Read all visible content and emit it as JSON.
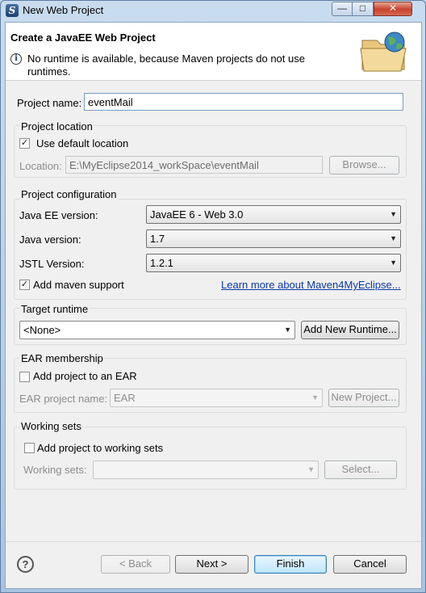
{
  "window": {
    "title": "New Web Project",
    "minimize_glyph": "—",
    "maximize_glyph": "□",
    "close_glyph": "✕"
  },
  "header": {
    "title": "Create a JavaEE Web Project",
    "message": "No runtime is available, because Maven projects do not use runtimes."
  },
  "project_name": {
    "label": "Project name:",
    "value": "eventMail"
  },
  "location_group": {
    "title": "Project location",
    "use_default_label": "Use default location",
    "use_default_checked": true,
    "location_label": "Location:",
    "location_value": "E:\\MyEclipse2014_workSpace\\eventMail",
    "browse_label": "Browse..."
  },
  "config_group": {
    "title": "Project configuration",
    "javaee_label": "Java EE version:",
    "javaee_value": "JavaEE 6 - Web 3.0",
    "java_label": "Java version:",
    "java_value": "1.7",
    "jstl_label": "JSTL Version:",
    "jstl_value": "1.2.1",
    "maven_label": "Add maven support",
    "maven_checked": true,
    "learn_more_link": "Learn more about Maven4MyEclipse..."
  },
  "runtime_group": {
    "title": "Target runtime",
    "value": "<None>",
    "add_runtime_label": "Add New Runtime..."
  },
  "ear_group": {
    "title": "EAR membership",
    "add_to_ear_label": "Add project to an EAR",
    "add_to_ear_checked": false,
    "ear_name_label": "EAR project name:",
    "ear_name_value": "EAR",
    "new_project_label": "New Project..."
  },
  "working_sets_group": {
    "title": "Working sets",
    "add_label": "Add project to working sets",
    "add_checked": false,
    "sets_label": "Working sets:",
    "sets_value": "",
    "select_label": "Select..."
  },
  "footer": {
    "help_glyph": "?",
    "back_label": "< Back",
    "next_label": "Next >",
    "finish_label": "Finish",
    "cancel_label": "Cancel"
  },
  "icons": {
    "dropdown_arrow": "▼",
    "check_mark": "✓",
    "info_glyph": "i"
  }
}
